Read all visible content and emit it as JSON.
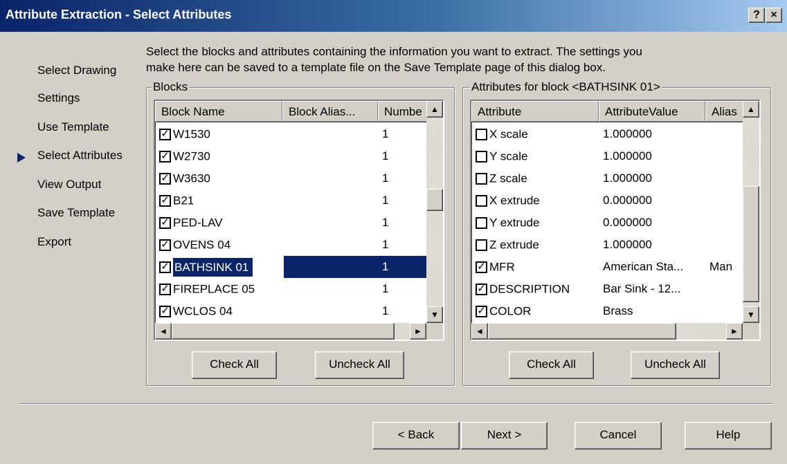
{
  "window": {
    "title": "Attribute Extraction - Select Attributes",
    "help_button": "?",
    "close_button": "×"
  },
  "sidebar": {
    "items": [
      {
        "label": "Select Drawing"
      },
      {
        "label": "Settings"
      },
      {
        "label": "Use Template"
      },
      {
        "label": "Select Attributes",
        "current": true
      },
      {
        "label": "View Output"
      },
      {
        "label": "Save Template"
      },
      {
        "label": "Export"
      }
    ]
  },
  "intro": {
    "line1": "Select the blocks and attributes containing the information you want to extract.  The settings you",
    "line2": "make here can be saved to a template file on the Save Template page of this dialog box."
  },
  "blocks": {
    "group_label": "Blocks",
    "columns": [
      "Block Name",
      "Block Alias...",
      "Numbe"
    ],
    "rows": [
      {
        "name": "W1530",
        "alias": "",
        "number": "1",
        "checked": true
      },
      {
        "name": "W2730",
        "alias": "",
        "number": "1",
        "checked": true
      },
      {
        "name": "W3630",
        "alias": "",
        "number": "1",
        "checked": true
      },
      {
        "name": "B21",
        "alias": "",
        "number": "1",
        "checked": true
      },
      {
        "name": "PED-LAV",
        "alias": "",
        "number": "1",
        "checked": true
      },
      {
        "name": "OVENS 04",
        "alias": "",
        "number": "1",
        "checked": true
      },
      {
        "name": "BATHSINK 01",
        "alias": "",
        "number": "1",
        "checked": true,
        "selected": true
      },
      {
        "name": "FIREPLACE 05",
        "alias": "",
        "number": "1",
        "checked": true
      },
      {
        "name": "WCLOS 04",
        "alias": "",
        "number": "1",
        "checked": true
      }
    ],
    "check_all": "Check All",
    "uncheck_all": "Uncheck All"
  },
  "attributes": {
    "group_label": "Attributes for block <BATHSINK 01>",
    "columns": [
      "Attribute",
      "AttributeValue",
      "Alias"
    ],
    "rows": [
      {
        "name": "X scale",
        "value": "1.000000",
        "alias": "",
        "checked": false
      },
      {
        "name": "Y scale",
        "value": "1.000000",
        "alias": "",
        "checked": false
      },
      {
        "name": "Z scale",
        "value": "1.000000",
        "alias": "",
        "checked": false
      },
      {
        "name": "X extrude",
        "value": "0.000000",
        "alias": "",
        "checked": false
      },
      {
        "name": "Y extrude",
        "value": "0.000000",
        "alias": "",
        "checked": false
      },
      {
        "name": "Z extrude",
        "value": "1.000000",
        "alias": "",
        "checked": false
      },
      {
        "name": "MFR",
        "value": "American Sta...",
        "alias": "Man",
        "checked": true
      },
      {
        "name": "DESCRIPTION",
        "value": "Bar Sink - 12...",
        "alias": "",
        "checked": true
      },
      {
        "name": "COLOR",
        "value": "Brass",
        "alias": "",
        "checked": true
      }
    ],
    "check_all": "Check All",
    "uncheck_all": "Uncheck All"
  },
  "footer": {
    "back": "< Back",
    "next": "Next >",
    "cancel": "Cancel",
    "help": "Help"
  },
  "icons": {
    "check_glyph": "✓",
    "up_arrow": "▲",
    "down_arrow": "▼",
    "left_arrow": "◄",
    "right_arrow": "►"
  },
  "colors": {
    "title_start": "#0a246a",
    "title_end": "#a6caf0",
    "selection": "#0a246a",
    "face": "#d4d0c8"
  }
}
